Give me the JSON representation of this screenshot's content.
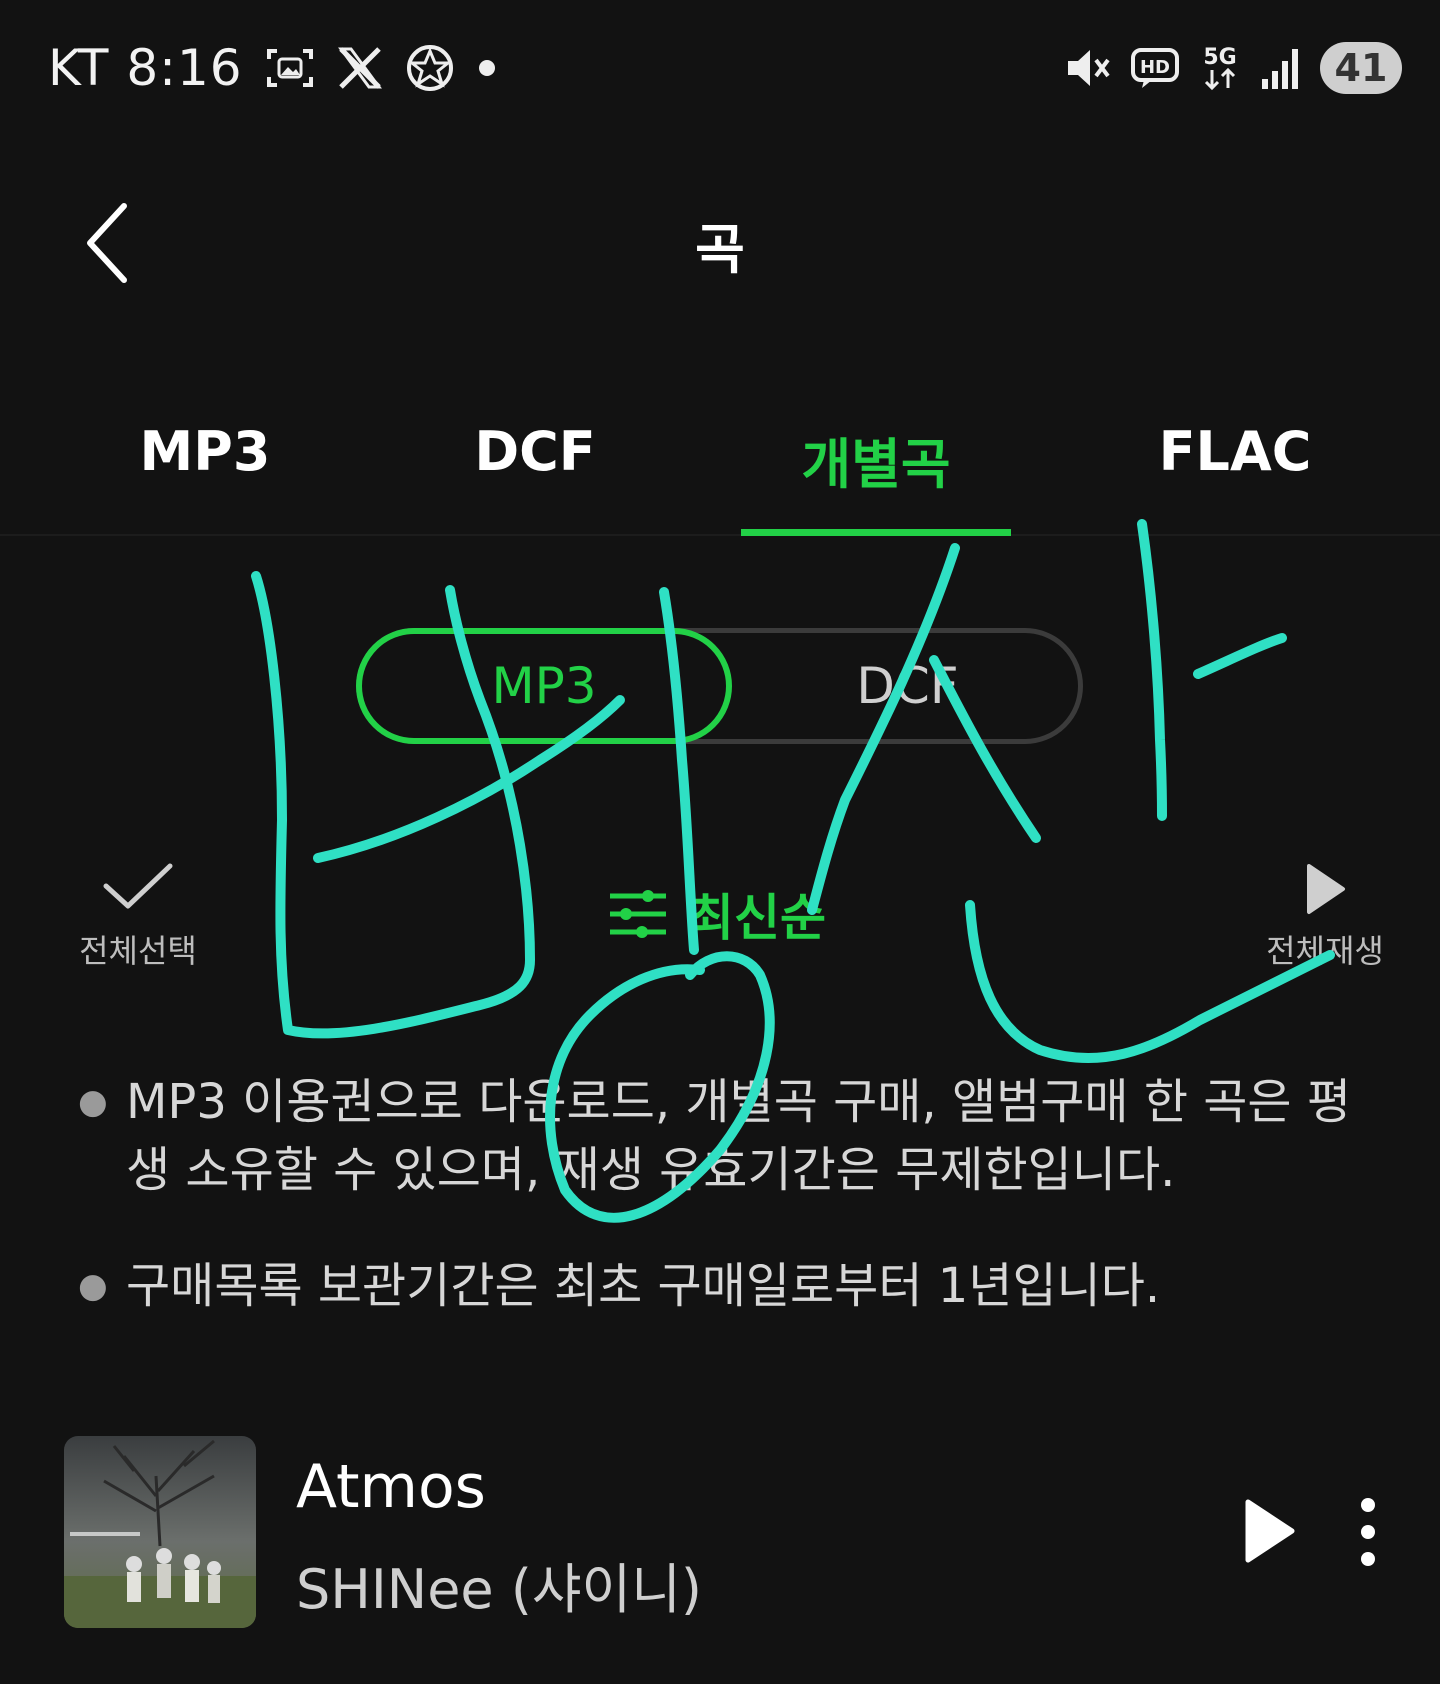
{
  "status_bar": {
    "carrier_time": "KT 8:16",
    "network_label": "5G",
    "hd_label": "HD",
    "battery": "41"
  },
  "header": {
    "title": "곡"
  },
  "tabs": [
    {
      "label": "MP3",
      "active": false
    },
    {
      "label": "DCF",
      "active": false
    },
    {
      "label": "개별곡",
      "active": true
    },
    {
      "label": "FLAC",
      "active": false
    }
  ],
  "format_toggle": {
    "options": [
      "MP3",
      "DCF"
    ],
    "selected": "MP3"
  },
  "actions": {
    "select_all": "전체선택",
    "sort": "최신순",
    "play_all": "전체재생"
  },
  "notices": [
    "MP3 이용권으로 다운로드, 개별곡 구매, 앨범구매 한 곡은 평생 소유할 수 있으며, 재생 유효기간은 무제한입니다.",
    "구매목록 보관기간은 최초 구매일로부터 1년입니다."
  ],
  "tracks": [
    {
      "title": "Atmos",
      "artist": "SHINee (샤이니)"
    }
  ],
  "colors": {
    "accent": "#22d147",
    "background": "#121212",
    "scribble": "#2fe0c4"
  }
}
